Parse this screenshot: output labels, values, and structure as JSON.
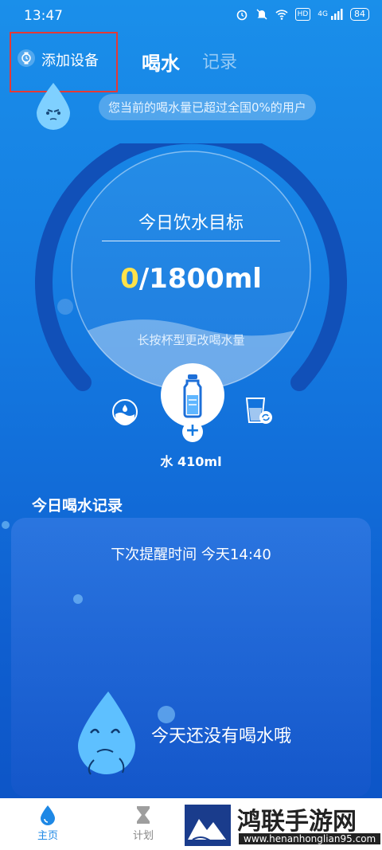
{
  "status_bar": {
    "time": "13:47",
    "battery": "84",
    "hd": "HD",
    "network": "4G"
  },
  "header": {
    "add_device": "添加设备",
    "tab_drink": "喝水",
    "tab_record": "记录"
  },
  "bubble_text": "您当前的喝水量已超过全国0%的用户",
  "goal": {
    "title": "今日饮水目标",
    "current": "0",
    "target": "/1800ml",
    "hint": "长按杯型更改喝水量",
    "progress": 0
  },
  "cup": {
    "amount_label": "水 410ml"
  },
  "record": {
    "title": "今日喝水记录",
    "reminder": "下次提醒时间 今天14:40",
    "empty": "今天还没有喝水哦"
  },
  "nav": {
    "home": "主页",
    "plan": "计划"
  },
  "watermark": {
    "title": "鸿联手游网",
    "url": "www.henanhonglian95.com"
  },
  "colors": {
    "accent": "#1479e0",
    "highlight": "#ffe24a",
    "alert_border": "#e53935"
  }
}
